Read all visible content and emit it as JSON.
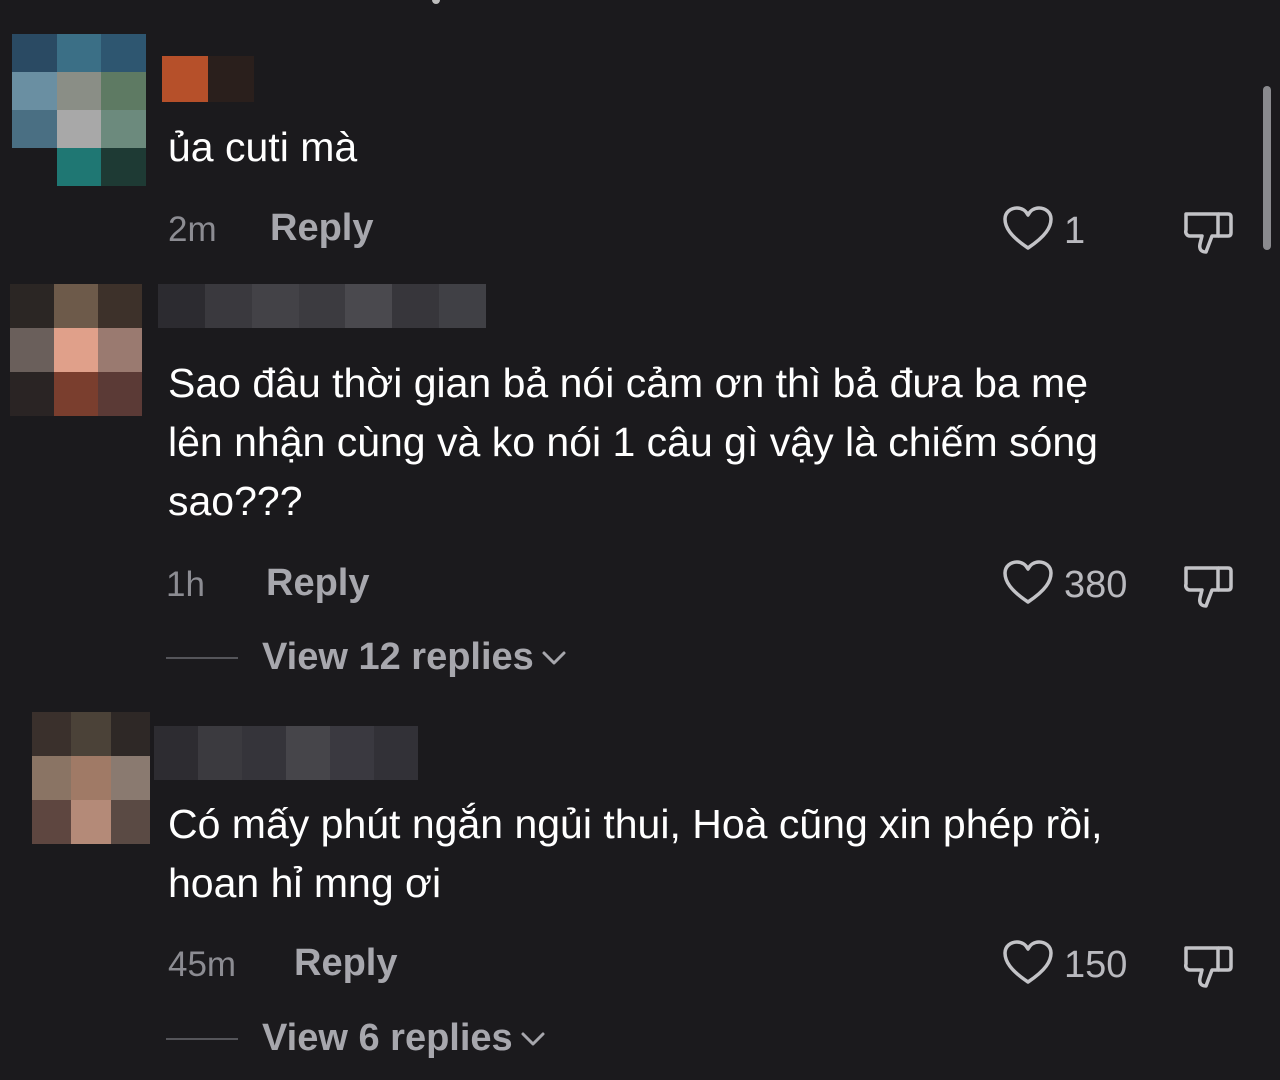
{
  "comments": [
    {
      "text": "ủa cuti mà",
      "time": "2m",
      "reply_label": "Reply",
      "likes": "1"
    },
    {
      "text": "Sao đâu thời gian bả nói cảm ơn thì bả đưa ba mẹ\nlên nhận cùng và ko nói 1 câu gì vậy là chiếm sóng\nsao???",
      "time": "1h",
      "reply_label": "Reply",
      "likes": "380",
      "view_replies": "View 12 replies"
    },
    {
      "text": "Có mấy phút ngắn ngủi thui, Hoà cũng xin phép rồi,\nhoan hỉ mng ơi",
      "time": "45m",
      "reply_label": "Reply",
      "likes": "150",
      "view_replies": "View 6 replies"
    }
  ],
  "icons": {
    "like": "heart-outline-icon",
    "dislike": "thumbs-down-outline-icon",
    "expand": "chevron-down-icon"
  },
  "colors": {
    "background": "#1b1a1d",
    "text": "#ffffff",
    "muted": "#8c8c92",
    "action": "#a7a7ad"
  }
}
